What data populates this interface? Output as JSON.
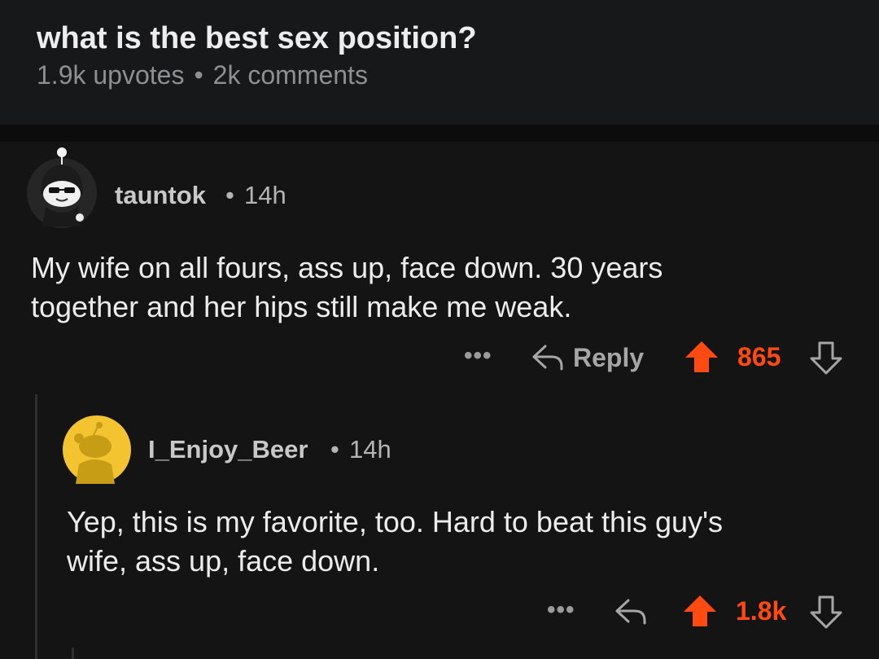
{
  "post": {
    "title": "what is the best sex position?",
    "upvotes": "1.9k upvotes",
    "separator": "•",
    "comments": "2k comments"
  },
  "comments": [
    {
      "username": "tauntok",
      "separator": "•",
      "age": "14h",
      "body_line1": "My wife on all fours, ass up, face down.  30 years",
      "body_line2": "together and her hips still make me weak.",
      "more": "•••",
      "reply_label": "Reply",
      "score": "865",
      "avatar_icon": "snoo-sunglasses-avatar-icon"
    },
    {
      "username": "I_Enjoy_Beer",
      "separator": "•",
      "age": "14h",
      "body_line1": "Yep, this is my favorite, too.  Hard to beat this guy's",
      "body_line2": "wife, ass up, face down.",
      "more": "•••",
      "score": "1.8k",
      "avatar_icon": "snoo-default-yellow-avatar-icon"
    }
  ],
  "colors": {
    "upvote": "#ff4a12",
    "background": "#141414",
    "avatar_yellow": "#f4c430"
  }
}
